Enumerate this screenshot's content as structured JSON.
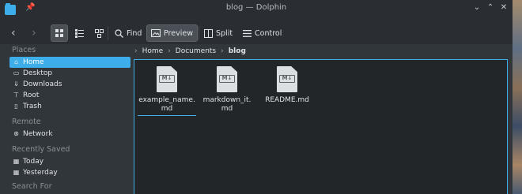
{
  "window": {
    "title": "blog — Dolphin"
  },
  "toolbar": {
    "back_glyph": "‹",
    "forward_glyph": "›",
    "find_label": "Find",
    "preview_label": "Preview",
    "split_label": "Split",
    "control_label": "Control"
  },
  "sidebar": {
    "places_title": "Places",
    "places": [
      {
        "label": "Home",
        "icon": "home-icon",
        "selected": true
      },
      {
        "label": "Desktop",
        "icon": "desktop-icon"
      },
      {
        "label": "Downloads",
        "icon": "downloads-icon"
      },
      {
        "label": "Root",
        "icon": "root-icon"
      },
      {
        "label": "Trash",
        "icon": "trash-icon"
      }
    ],
    "remote_title": "Remote",
    "remote": [
      {
        "label": "Network",
        "icon": "network-icon"
      }
    ],
    "recent_title": "Recently Saved",
    "recent": [
      {
        "label": "Today",
        "icon": "calendar-icon"
      },
      {
        "label": "Yesterday",
        "icon": "calendar-icon"
      }
    ],
    "search_title": "Search For"
  },
  "breadcrumb": {
    "items": [
      "Home",
      "Documents",
      "blog"
    ]
  },
  "files": [
    {
      "name": "example_name.\nmd",
      "icon_text": "M↓"
    },
    {
      "name": "markdown_it.\nmd",
      "icon_text": "M↓"
    },
    {
      "name": "README.md",
      "icon_text": "M↓"
    }
  ],
  "colors": {
    "accent": "#3daee9",
    "window_bg": "#31363b",
    "view_bg": "#232629"
  }
}
